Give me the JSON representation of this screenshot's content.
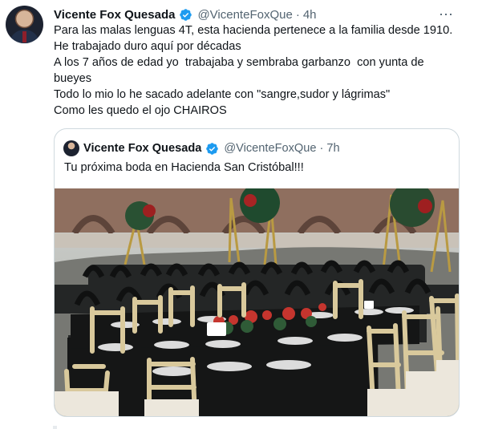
{
  "tweet": {
    "author_name": "Vicente Fox Quesada",
    "handle": "@VicenteFoxQue",
    "separator": "·",
    "time": "4h",
    "more_label": "⋯",
    "lines": [
      "Para las malas lenguas 4T, esta hacienda pertenece a la familia desde 1910.",
      "He trabajado duro aquí por décadas",
      "A los 7 años de edad yo  trabajaba y sembraba garbanzo  con yunta de",
      "bueyes",
      "Todo lo mio lo he sacado adelante con \"sangre,sudor y lágrimas\"",
      "Como les quedo el ojo CHAIROS"
    ]
  },
  "quote": {
    "author_name": "Vicente Fox Quesada",
    "handle": "@VicenteFoxQue",
    "separator": "·",
    "time": "7h",
    "text": "Tu próxima boda en Hacienda San Cristóbal!!!"
  },
  "icons": {
    "verified": "verified-badge-icon",
    "more": "more-icon"
  },
  "colors": {
    "verified_blue": "#1d9bf0",
    "muted_text": "#536471",
    "border": "#cfd9de"
  }
}
